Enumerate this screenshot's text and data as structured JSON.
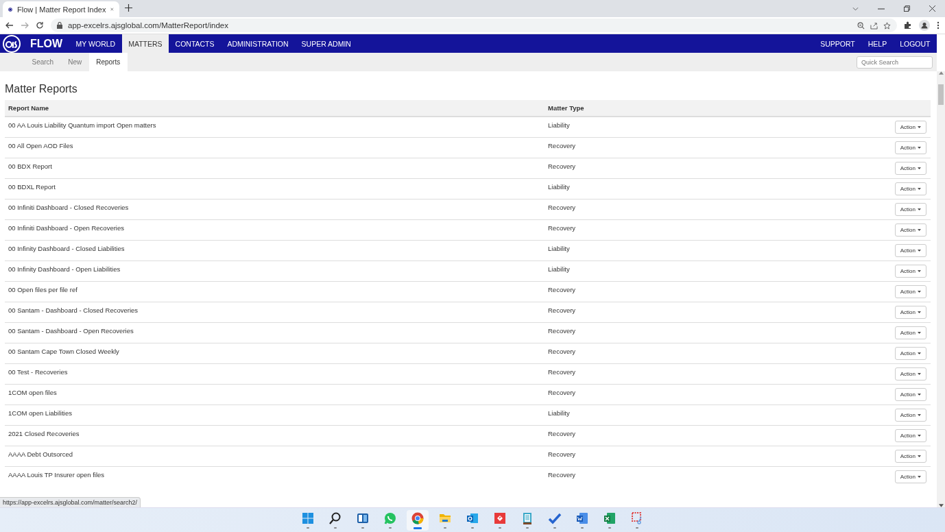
{
  "browser": {
    "tab_title": "Flow | Matter Report Index",
    "url": "app-excelrs.ajsglobal.com/MatterReport/index"
  },
  "app": {
    "brand": "FLOW",
    "nav": [
      {
        "label": "MY WORLD",
        "selected": false
      },
      {
        "label": "MATTERS",
        "selected": true
      },
      {
        "label": "CONTACTS",
        "selected": false
      },
      {
        "label": "ADMINISTRATION",
        "selected": false
      },
      {
        "label": "SUPER ADMIN",
        "selected": false
      }
    ],
    "nav_right": [
      "SUPPORT",
      "HELP",
      "LOGOUT"
    ],
    "subtabs": [
      {
        "label": "Search",
        "selected": false
      },
      {
        "label": "New",
        "selected": false
      },
      {
        "label": "Reports",
        "selected": true
      }
    ],
    "quick_search": {
      "placeholder": "Quick Search"
    }
  },
  "heading": "Matter Reports",
  "table": {
    "columns": [
      "Report Name",
      "Matter Type"
    ],
    "rows": [
      {
        "name": "00 AA Louis Liability Quantum import Open matters",
        "type": "Liability",
        "action": "Action"
      },
      {
        "name": "00 All Open AOD Files",
        "type": "Recovery",
        "action": "Action"
      },
      {
        "name": "00 BDX Report",
        "type": "Recovery",
        "action": "Action"
      },
      {
        "name": "00 BDXL Report",
        "type": "Liability",
        "action": "Action"
      },
      {
        "name": "00 Infiniti Dashboard - Closed Recoveries",
        "type": "Recovery",
        "action": "Action"
      },
      {
        "name": "00 Infiniti Dashboard - Open Recoveries",
        "type": "Recovery",
        "action": "Action"
      },
      {
        "name": "00 Infinity Dashboard - Closed Liabilities",
        "type": "Liability",
        "action": "Action"
      },
      {
        "name": "00 Infinity Dashboard - Open Liabilities",
        "type": "Liability",
        "action": "Action"
      },
      {
        "name": "00 Open files per file ref",
        "type": "Recovery",
        "action": "Action"
      },
      {
        "name": "00 Santam - Dashboard - Closed Recoveries",
        "type": "Recovery",
        "action": "Action"
      },
      {
        "name": "00 Santam - Dashboard - Open Recoveries",
        "type": "Recovery",
        "action": "Action"
      },
      {
        "name": "00 Santam Cape Town Closed Weekly",
        "type": "Recovery",
        "action": "Action"
      },
      {
        "name": "00 Test - Recoveries",
        "type": "Recovery",
        "action": "Action"
      },
      {
        "name": "1COM open files",
        "type": "Recovery",
        "action": "Action"
      },
      {
        "name": "1COM open Liabilities",
        "type": "Liability",
        "action": "Action"
      },
      {
        "name": "2021 Closed Recoveries",
        "type": "Recovery",
        "action": "Action"
      },
      {
        "name": "AAAA Debt Outsorced",
        "type": "Recovery",
        "action": "Action"
      },
      {
        "name": "AAAA Louis TP Insurer open files",
        "type": "Recovery",
        "action": "Action"
      }
    ]
  },
  "status_url": "https://app-excelrs.ajsglobal.com/matter/search2/",
  "taskbar": [
    {
      "kind": "start",
      "active": false
    },
    {
      "kind": "search",
      "active": false
    },
    {
      "kind": "widgets",
      "active": false
    },
    {
      "kind": "chat",
      "active": false
    },
    {
      "kind": "browser",
      "active": true
    },
    {
      "kind": "folder",
      "active": false
    },
    {
      "kind": "mail",
      "active": false
    },
    {
      "kind": "remote",
      "active": false
    },
    {
      "kind": "notepad",
      "active": false
    },
    {
      "kind": "todo",
      "active": false
    },
    {
      "kind": "word",
      "active": false
    },
    {
      "kind": "excel",
      "active": false
    },
    {
      "kind": "snip",
      "active": false
    }
  ]
}
